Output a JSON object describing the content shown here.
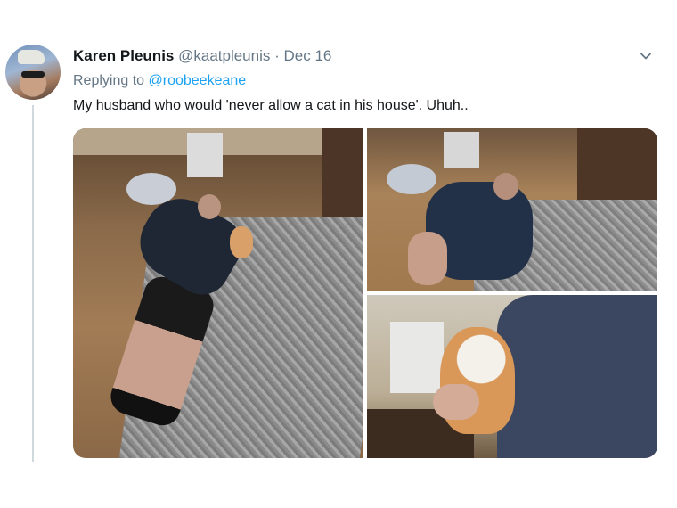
{
  "tweet": {
    "author_name": "Karen Pleunis",
    "author_handle": "@kaatpleunis",
    "separator": "·",
    "date": "Dec 16",
    "reply_prefix": "Replying to",
    "reply_mention": "@roobeekeane",
    "text": "My husband who would 'never allow a cat in his house'. Uhuh..",
    "menu_icon": "chevron-down-icon",
    "media": [
      {
        "description_icon": "photo-1"
      },
      {
        "description_icon": "photo-2"
      },
      {
        "description_icon": "photo-3"
      }
    ]
  },
  "colors": {
    "text": "#14171a",
    "muted": "#657786",
    "link": "#1da1f2",
    "thread_line": "#cfd9de"
  }
}
